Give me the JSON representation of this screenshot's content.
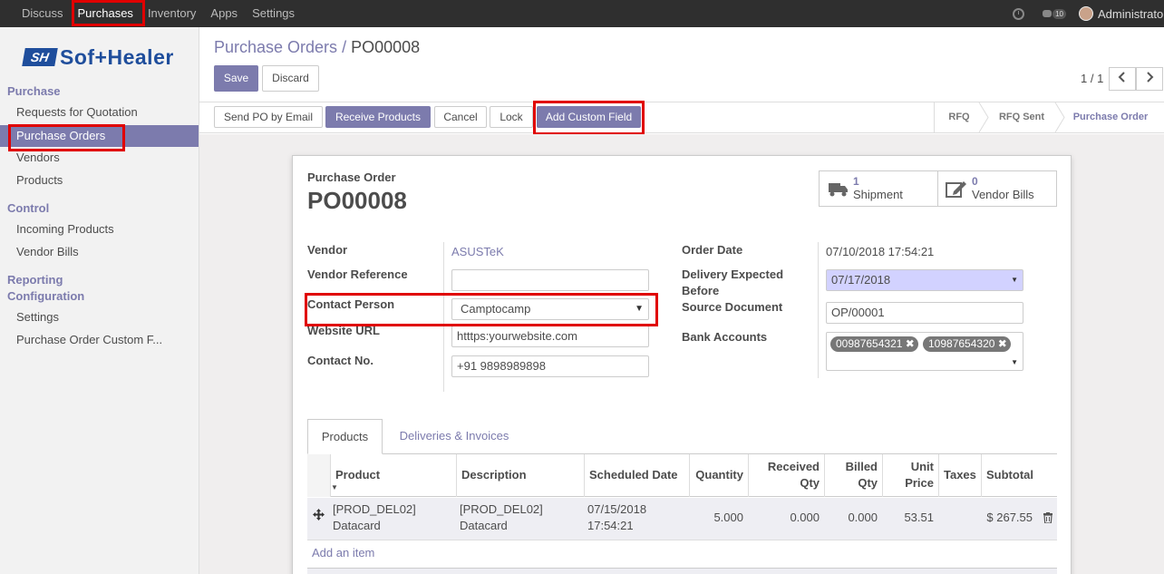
{
  "topbar": {
    "menu": [
      "Discuss",
      "Purchases",
      "Inventory",
      "Apps",
      "Settings"
    ],
    "active": "Purchases",
    "chat_count": "10",
    "user": "Administrator"
  },
  "sidebar": {
    "logo_mark": "SH",
    "logo_text": "Sof+Healer",
    "sections": {
      "purchase": "Purchase",
      "control": "Control",
      "reporting": "Reporting",
      "configuration": "Configuration"
    },
    "items": {
      "rfq": "Requests for Quotation",
      "purchase_orders": "Purchase Orders",
      "vendors": "Vendors",
      "products": "Products",
      "incoming_products": "Incoming Products",
      "vendor_bills": "Vendor Bills",
      "settings": "Settings",
      "custom_fields": "Purchase Order Custom F..."
    }
  },
  "control_panel": {
    "breadcrumb_parent": "Purchase Orders",
    "breadcrumb_sep": "/",
    "breadcrumb_current": "PO00008",
    "save": "Save",
    "discard": "Discard",
    "pager": "1 / 1",
    "prev_icon": "chevron-left-icon",
    "next_icon": "chevron-right-icon"
  },
  "actions": {
    "send_po": "Send PO by Email",
    "receive_products": "Receive Products",
    "cancel": "Cancel",
    "lock": "Lock",
    "add_custom_field": "Add Custom Field"
  },
  "statusbar": [
    "RFQ",
    "RFQ Sent",
    "Purchase Order"
  ],
  "statusbar_current": "Purchase Order",
  "form": {
    "doc_label": "Purchase Order",
    "doc_name": "PO00008",
    "shipment_count": "1",
    "shipment_label": "Shipment",
    "bills_count": "0",
    "bills_label": "Vendor Bills",
    "left": {
      "vendor_label": "Vendor",
      "vendor_value": "ASUSTeK",
      "vendor_ref_label": "Vendor Reference",
      "vendor_ref_value": "",
      "contact_label": "Contact Person",
      "contact_value": "Camptocamp",
      "website_label": "Website URL",
      "website_value": "htttps:yourwebsite.com",
      "contact_no_label": "Contact No.",
      "contact_no_value": "+91 9898989898"
    },
    "right": {
      "order_date_label": "Order Date",
      "order_date_value": "07/10/2018 17:54:21",
      "delivery_label_1": "Delivery Expected",
      "delivery_label_2": "Before",
      "delivery_value": "07/17/2018",
      "source_label": "Source Document",
      "source_value": "OP/00001",
      "bank_label": "Bank Accounts",
      "bank_tags": [
        "00987654321",
        "10987654320"
      ]
    }
  },
  "tabs": [
    "Products",
    "Deliveries & Invoices"
  ],
  "table": {
    "headers": {
      "product": "Product",
      "description": "Description",
      "scheduled": "Scheduled Date",
      "quantity": "Quantity",
      "received_1": "Received",
      "received_2": "Qty",
      "billed_1": "Billed",
      "billed_2": "Qty",
      "unit_1": "Unit",
      "unit_2": "Price",
      "taxes": "Taxes",
      "subtotal": "Subtotal"
    },
    "row": {
      "product_1": "[PROD_DEL02]",
      "product_2": "Datacard",
      "description_1": "[PROD_DEL02]",
      "description_2": "Datacard",
      "scheduled_1": "07/15/2018",
      "scheduled_2": "17:54:21",
      "quantity": "5.000",
      "received": "0.000",
      "billed": "0.000",
      "unit_price": "53.51",
      "taxes": "",
      "subtotal": "$ 267.55"
    },
    "add_item": "Add an item"
  },
  "colors": {
    "accent": "#7c7bad",
    "highlight": "#e00000",
    "topbar": "#2f2f2f"
  }
}
